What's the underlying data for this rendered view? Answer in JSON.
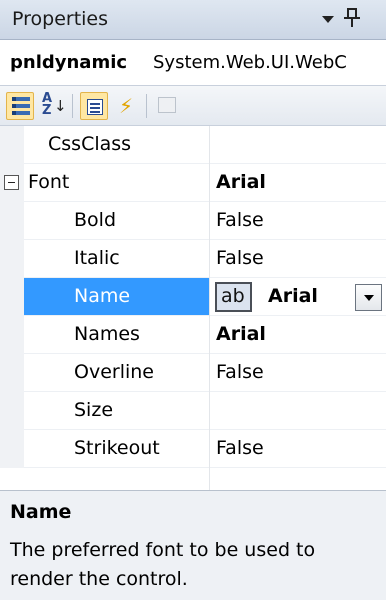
{
  "window": {
    "title": "Properties"
  },
  "object_selector": {
    "name": "pnldynamic",
    "type": "System.Web.UI.WebC"
  },
  "toolbar": {
    "buttons": [
      {
        "icon": "categorized-icon",
        "active": true
      },
      {
        "icon": "alphabetical-icon",
        "active": false
      },
      {
        "icon": "properties-icon",
        "active": true
      },
      {
        "icon": "events-icon",
        "active": false
      },
      {
        "icon": "property-pages-icon",
        "active": false
      }
    ]
  },
  "properties": [
    {
      "name": "CssClass",
      "value": "",
      "indent": 1
    },
    {
      "name": "Font",
      "value": "Arial",
      "indent": 0,
      "expanded": true,
      "bold_value": true
    },
    {
      "name": "Bold",
      "value": "False",
      "indent": 2
    },
    {
      "name": "Italic",
      "value": "False",
      "indent": 2
    },
    {
      "name": "Name",
      "value": "Arial",
      "indent": 2,
      "selected": true,
      "preview": "ab"
    },
    {
      "name": "Names",
      "value": "Arial",
      "indent": 2,
      "bold_value": true
    },
    {
      "name": "Overline",
      "value": "False",
      "indent": 2
    },
    {
      "name": "Size",
      "value": "",
      "indent": 2
    },
    {
      "name": "Strikeout",
      "value": "False",
      "indent": 2
    }
  ],
  "description": {
    "title": "Name",
    "text": "The preferred font to be used to render the control."
  },
  "colors": {
    "selection": "#3399ff",
    "titlebar": "#d6e0ec"
  }
}
